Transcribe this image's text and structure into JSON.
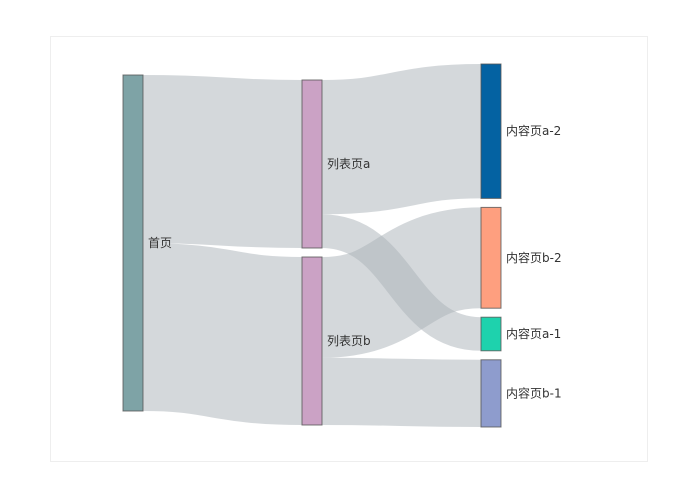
{
  "chart_data": {
    "type": "sankey",
    "nodes": [
      {
        "name": "首页",
        "color": "#7ea3a6",
        "column": 0
      },
      {
        "name": "列表页a",
        "color": "#cba2c5",
        "column": 1
      },
      {
        "name": "列表页b",
        "color": "#cba2c5",
        "column": 1
      },
      {
        "name": "内容页a-2",
        "color": "#0462a2",
        "column": 2
      },
      {
        "name": "内容页b-2",
        "color": "#fe9f7f",
        "column": 2
      },
      {
        "name": "内容页a-1",
        "color": "#1ed2ad",
        "column": 2
      },
      {
        "name": "内容页b-1",
        "color": "#8e9ccd",
        "column": 2
      }
    ],
    "links": [
      {
        "source": "首页",
        "target": "列表页a",
        "value": 5
      },
      {
        "source": "首页",
        "target": "列表页b",
        "value": 5
      },
      {
        "source": "列表页a",
        "target": "内容页a-2",
        "value": 4
      },
      {
        "source": "列表页a",
        "target": "内容页a-1",
        "value": 1
      },
      {
        "source": "列表页b",
        "target": "内容页b-2",
        "value": 3
      },
      {
        "source": "列表页b",
        "target": "内容页b-1",
        "value": 2
      }
    ],
    "link_color": "#aab1b8",
    "node_border_color": "#555555"
  }
}
